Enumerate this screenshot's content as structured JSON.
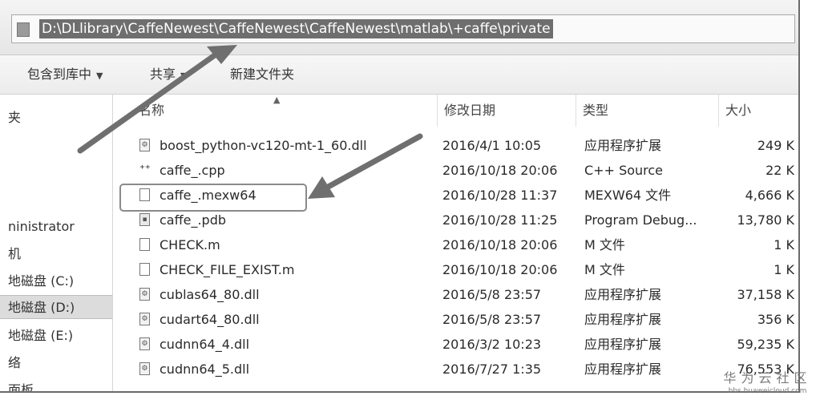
{
  "address": {
    "path": "D:\\DLlibrary\\CaffeNewest\\CaffeNewest\\CaffeNewest\\matlab\\+caffe\\private"
  },
  "toolbar": {
    "include_label": "包含到库中",
    "share_label": "共享",
    "new_folder_label": "新建文件夹"
  },
  "nav": {
    "items": [
      {
        "label": "夹"
      },
      {
        "label": "ninistrator"
      },
      {
        "label": "机"
      },
      {
        "label": "地磁盘 (C:)"
      },
      {
        "label": "地磁盘 (D:)"
      },
      {
        "label": "地磁盘 (E:)"
      },
      {
        "label": "络"
      },
      {
        "label": "面板"
      }
    ]
  },
  "columns": {
    "name": "名称",
    "date": "修改日期",
    "type": "类型",
    "size": "大小"
  },
  "files": [
    {
      "name": "boost_python-vc120-mt-1_60.dll",
      "date": "2016/4/1 10:05",
      "type": "应用程序扩展",
      "size": "249 K",
      "icon": "dll-file-icon"
    },
    {
      "name": "caffe_.cpp",
      "date": "2016/10/18 20:06",
      "type": "C++ Source",
      "size": "22 K",
      "icon": "cpp-file-icon"
    },
    {
      "name": "caffe_.mexw64",
      "date": "2016/10/28 11:37",
      "type": "MEXW64 文件",
      "size": "4,666 K",
      "icon": "generic-file-icon"
    },
    {
      "name": "caffe_.pdb",
      "date": "2016/10/28 11:25",
      "type": "Program Debug...",
      "size": "13,780 K",
      "icon": "pdb-file-icon"
    },
    {
      "name": "CHECK.m",
      "date": "2016/10/18 20:06",
      "type": "M 文件",
      "size": "1 K",
      "icon": "generic-file-icon"
    },
    {
      "name": "CHECK_FILE_EXIST.m",
      "date": "2016/10/18 20:06",
      "type": "M 文件",
      "size": "1 K",
      "icon": "generic-file-icon"
    },
    {
      "name": "cublas64_80.dll",
      "date": "2016/5/8 23:57",
      "type": "应用程序扩展",
      "size": "37,158 K",
      "icon": "dll-file-icon"
    },
    {
      "name": "cudart64_80.dll",
      "date": "2016/5/8 23:57",
      "type": "应用程序扩展",
      "size": "356 K",
      "icon": "dll-file-icon"
    },
    {
      "name": "cudnn64_4.dll",
      "date": "2016/3/2 10:23",
      "type": "应用程序扩展",
      "size": "59,235 K",
      "icon": "dll-file-icon"
    },
    {
      "name": "cudnn64_5.dll",
      "date": "2016/7/27 1:35",
      "type": "应用程序扩展",
      "size": "76,553 K",
      "icon": "dll-file-icon"
    }
  ],
  "watermark": {
    "main": "华为云社区",
    "sub": "bbs.huaweicloud.com"
  }
}
